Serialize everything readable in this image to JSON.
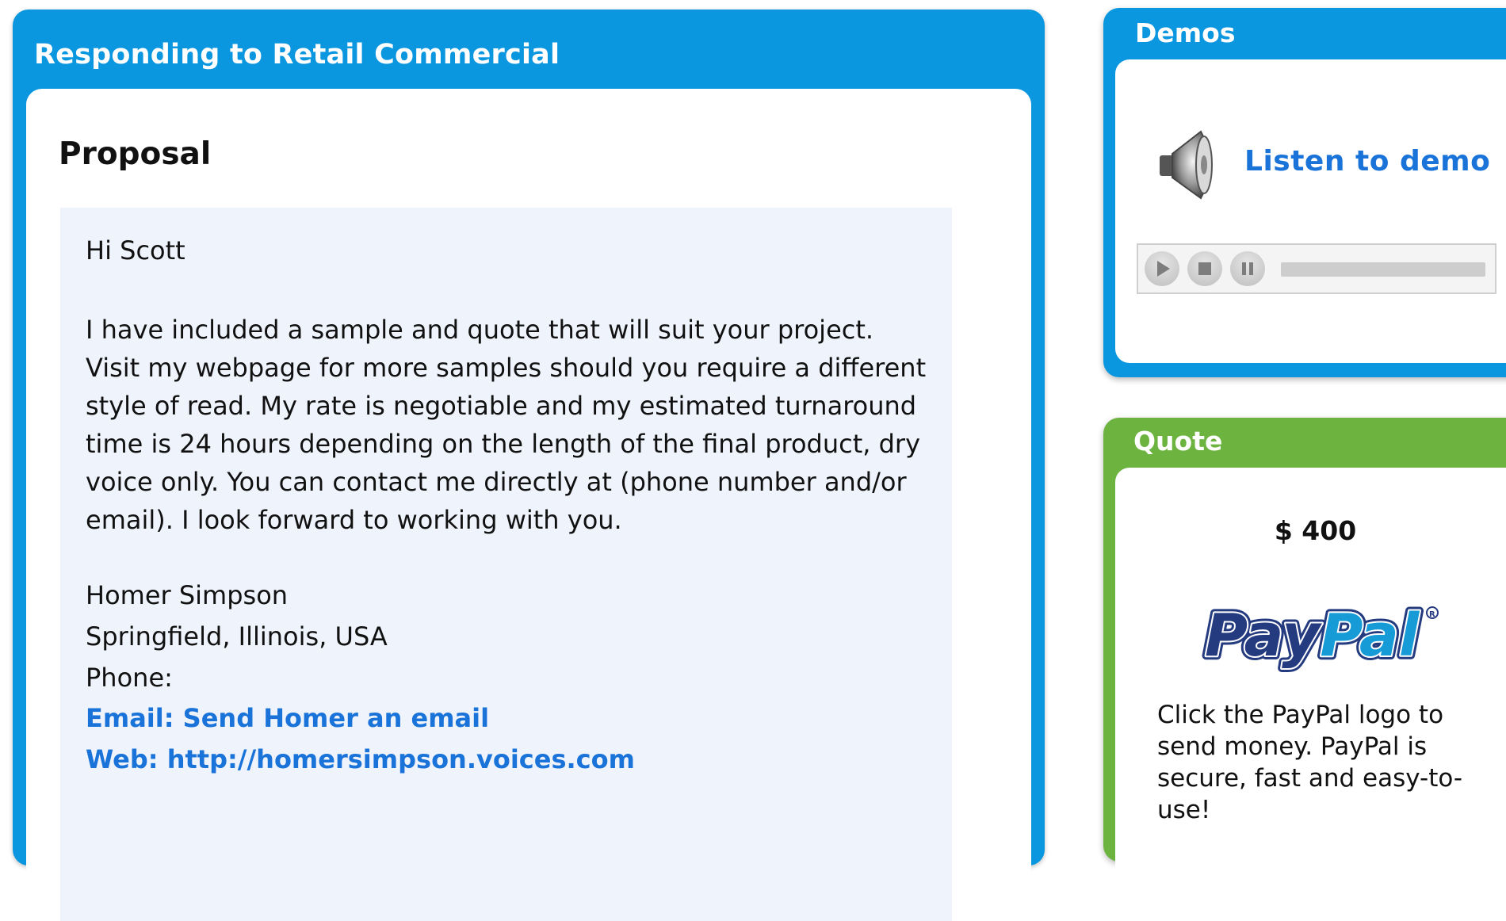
{
  "proposal_panel": {
    "title": "Responding to Retail Commercial",
    "heading": "Proposal",
    "greeting": "Hi Scott",
    "body": "I have included a sample and quote that will suit your project. Visit my webpage for more samples should you require a different style of read. My rate is negotiable and my estimated turnaround time is 24 hours depending on the length of the final product, dry voice only. You can contact me directly at (phone number and/or email). I look forward to working with you.",
    "signature": {
      "name": "Homer Simpson",
      "location": "Springfield, Illinois, USA",
      "phone": "Phone:",
      "email_link": "Email: Send Homer an email",
      "web_link": "Web: http://homersimpson.voices.com"
    }
  },
  "demos_panel": {
    "title": "Demos",
    "listen_link": "Listen to demo",
    "player_buttons": [
      "play-icon",
      "stop-icon",
      "pause-icon"
    ]
  },
  "quote_panel": {
    "title": "Quote",
    "amount": "$ 400",
    "paypal_logo_text": "PayPal",
    "paypal_note": "Click the PayPal logo to send money. PayPal is secure, fast and easy-to-use!"
  },
  "colors": {
    "blue_panel": "#0b97e0",
    "green_panel": "#6db33f",
    "link_blue": "#1a73d9",
    "letter_bg": "#eef3fc",
    "paypal_dark": "#253b80",
    "paypal_light": "#179bd7"
  }
}
